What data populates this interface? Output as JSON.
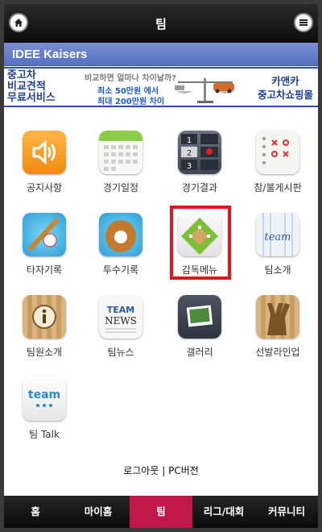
{
  "header": {
    "title": "팀",
    "home_icon": "home-icon",
    "menu_icon": "menu-icon"
  },
  "team_bar": {
    "name": "IDEE Kaisers"
  },
  "ad": {
    "left_lines": [
      "중고차",
      "비교견적",
      "무료서비스"
    ],
    "headline": "비교하면 얼마나 차이날까?",
    "line1": "최소 50만원 에서",
    "line2": "최대 200만원 차이",
    "brand": "카앤카",
    "brand_sub": "중고차쇼핑몰"
  },
  "menu": [
    {
      "label": "공지사항",
      "icon": "speaker-icon"
    },
    {
      "label": "경기일정",
      "icon": "calendar-icon"
    },
    {
      "label": "경기결과",
      "icon": "scoreboard-icon"
    },
    {
      "label": "참/불게시판",
      "icon": "ox-board-icon"
    },
    {
      "label": "타자기록",
      "icon": "bat-icon"
    },
    {
      "label": "투수기록",
      "icon": "glove-icon"
    },
    {
      "label": "감독메뉴",
      "icon": "diamond-field-icon",
      "selected": true
    },
    {
      "label": "팀소개",
      "icon": "team-jersey-icon"
    },
    {
      "label": "팀원소개",
      "icon": "info-icon"
    },
    {
      "label": "팀뉴스",
      "icon": "team-news-icon"
    },
    {
      "label": "갤러리",
      "icon": "gallery-icon"
    },
    {
      "label": "선발라인업",
      "icon": "lineup-icon"
    },
    {
      "label": "팀 Talk",
      "icon": "team-talk-icon"
    }
  ],
  "footer_links": {
    "logout": "로그아웃",
    "separator": "|",
    "pc": "PC버전"
  },
  "tabs": [
    {
      "label": "홈"
    },
    {
      "label": "마이홈"
    },
    {
      "label": "팀",
      "active": true
    },
    {
      "label": "리그/대회"
    },
    {
      "label": "커뮤니티"
    }
  ],
  "colors": {
    "accent": "#c0184a",
    "team_bar": "#5670c2",
    "selection": "#e4141b"
  }
}
